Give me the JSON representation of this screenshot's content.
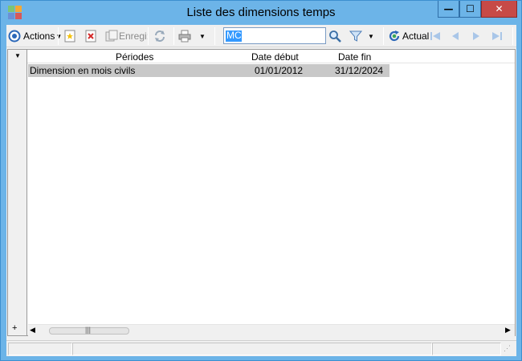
{
  "window": {
    "title": "Liste des dimensions temps",
    "controls": {
      "minimize": "—",
      "maximize": "☐",
      "close": "✕"
    }
  },
  "toolbar": {
    "actions_label": "Actions",
    "save_label": "Enregi:",
    "search_value": "MC",
    "refresh_label": "Actual"
  },
  "grid": {
    "columns": [
      "Périodes",
      "Date début",
      "Date fin"
    ],
    "rows": [
      {
        "periodes": "Dimension en mois civils",
        "date_debut": "01/01/2012",
        "date_fin": "31/12/2024"
      }
    ],
    "add_row": "+"
  },
  "colors": {
    "title_bar": "#6cb4e8",
    "close_button": "#c74a47",
    "selection": "#3399ff",
    "row_highlight": "#c8c8c8"
  }
}
